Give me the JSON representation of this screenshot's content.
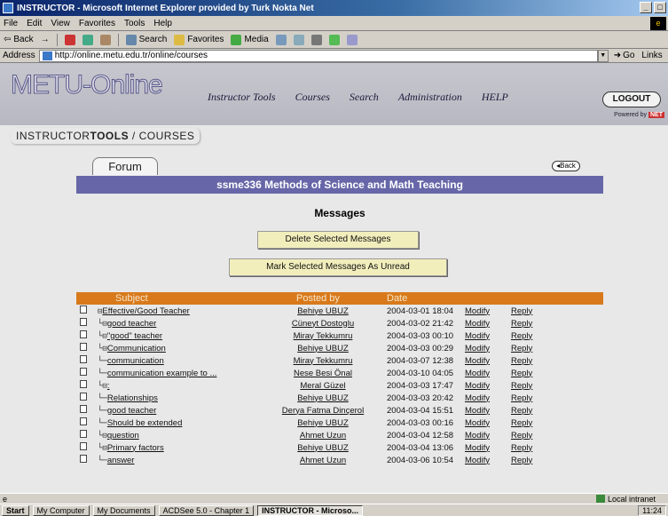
{
  "window": {
    "title": "INSTRUCTOR - Microsoft Internet Explorer provided by Turk Nokta Net"
  },
  "menu": [
    "File",
    "Edit",
    "View",
    "Favorites",
    "Tools",
    "Help"
  ],
  "toolbar": {
    "back": "Back",
    "search": "Search",
    "favorites": "Favorites",
    "media": "Media"
  },
  "address": {
    "label": "Address",
    "url": "http://online.metu.edu.tr/online/courses",
    "go": "Go",
    "links": "Links"
  },
  "site": {
    "logo": "METU-Online",
    "nav": [
      "Instructor Tools",
      "Courses",
      "Search",
      "Administration",
      "HELP"
    ],
    "logout": "LOGOUT",
    "powered_prefix": "Powered by",
    "powered_brand": "NET"
  },
  "breadcrumb": {
    "instructor": "INSTRUCTOR",
    "tools": "TOOLS",
    "rest": "/ COURSES"
  },
  "forum": {
    "tab": "Forum",
    "back": "Back",
    "course": "ssme336 Methods of Science and Math Teaching",
    "heading": "Messages",
    "delete_btn": "Delete Selected Messages",
    "unread_btn": "Mark Selected Messages As Unread"
  },
  "table": {
    "headers": [
      "Subject",
      "Posted by",
      "Date"
    ],
    "rows": [
      {
        "tree": "⊟ ",
        "subject": "Effective/Good Teacher",
        "author": "Behiye UBUZ",
        "date": "2004-03-01 18:04",
        "modify": "Modify",
        "reply": "Reply"
      },
      {
        "tree": "└⊟ ",
        "subject": "good teacher",
        "author": "Cüneyt Dostoglu",
        "date": "2004-03-02 21:42",
        "modify": "Modify",
        "reply": "Reply"
      },
      {
        "tree": "  └⊟ ",
        "subject": "\"good\" teacher",
        "author": "Miray Tekkumru",
        "date": "2004-03-03 00:10",
        "modify": "Modify",
        "reply": "Reply"
      },
      {
        "tree": "    └⊟ ",
        "subject": "Communication",
        "author": "Behiye UBUZ",
        "date": "2004-03-03 00:29",
        "modify": "Modify",
        "reply": "Reply"
      },
      {
        "tree": "      └─ ",
        "subject": "communication",
        "author": "Miray Tekkumru",
        "date": "2004-03-07 12:38",
        "modify": "Modify",
        "reply": "Reply"
      },
      {
        "tree": "      └─ ",
        "subject": "communication example to ...",
        "author": "Nese Besi Önal",
        "date": "2004-03-10 04:05",
        "modify": "Modify",
        "reply": "Reply"
      },
      {
        "tree": "    └⊟ ",
        "subject": ":",
        "author": "Meral Güzel",
        "date": "2004-03-03 17:47",
        "modify": "Modify",
        "reply": "Reply"
      },
      {
        "tree": "      └─ ",
        "subject": "Relationships",
        "author": "Behiye UBUZ",
        "date": "2004-03-03 20:42",
        "modify": "Modify",
        "reply": "Reply"
      },
      {
        "tree": "  └─ ",
        "subject": "good teacher",
        "author": "Derya Fatma Dinçerol",
        "date": "2004-03-04 15:51",
        "modify": "Modify",
        "reply": "Reply"
      },
      {
        "tree": "└─ ",
        "subject": "Should be extended",
        "author": "Behiye UBUZ",
        "date": "2004-03-03 00:16",
        "modify": "Modify",
        "reply": "Reply"
      },
      {
        "tree": "└⊟ ",
        "subject": "question",
        "author": "Ahmet Uzun",
        "date": "2004-03-04 12:58",
        "modify": "Modify",
        "reply": "Reply"
      },
      {
        "tree": "  └⊟ ",
        "subject": "Primary factors",
        "author": "Behiye UBUZ",
        "date": "2004-03-04 13:06",
        "modify": "Modify",
        "reply": "Reply"
      },
      {
        "tree": "    └─ ",
        "subject": "answer",
        "author": "Ahmet Uzun",
        "date": "2004-03-06 10:54",
        "modify": "Modify",
        "reply": "Reply"
      }
    ]
  },
  "status": {
    "zone": "Local intranet"
  },
  "taskbar": {
    "start": "Start",
    "tasks": [
      "My Computer",
      "My Documents",
      "ACDSee 5.0 - Chapter 1",
      "INSTRUCTOR - Microso..."
    ],
    "clock": "11:24"
  }
}
